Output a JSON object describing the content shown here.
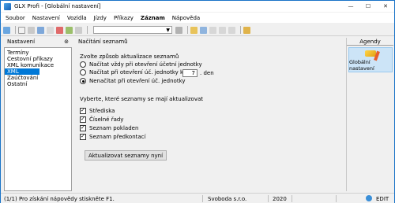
{
  "window": {
    "title": "GLX Profi - [Globální nastavení]"
  },
  "menubar": [
    "Soubor",
    "Nastavení",
    "Vozidla",
    "Jízdy",
    "Příkazy",
    "Záznam",
    "Nápověda"
  ],
  "left": {
    "header": "Nastavení",
    "items": [
      "Termíny",
      "Cestovní příkazy",
      "XML komunikace",
      "XML seznamy",
      "Zaúčtování",
      "Ostatní"
    ],
    "selected_index": 3
  },
  "content": {
    "section_title": "Načítání seznamů",
    "update_title": "Zvolte způsob aktualizace seznamů",
    "radios": [
      {
        "label": "Načítat vždy při otevření účetní jednotky",
        "checked": false
      },
      {
        "label": "Načítat při otevření úč. jednotky každý",
        "checked": false
      },
      {
        "label": "Nenačítat při otevření úč. jednotky",
        "checked": true
      }
    ],
    "interval_value": "7",
    "interval_unit": ". den",
    "lists_title": "Vyberte, které seznamy se mají aktualizovat",
    "checks": [
      {
        "label": "Střediska",
        "checked": true
      },
      {
        "label": "Číselné řady",
        "checked": true
      },
      {
        "label": "Seznam pokladen",
        "checked": true
      },
      {
        "label": "Seznam předkontací",
        "checked": true
      }
    ],
    "update_button": "Aktualizovat seznamy nyní"
  },
  "right": {
    "header": "Agendy",
    "tile_label": "Globální nastavení"
  },
  "status": {
    "hint": "(1/1) Pro získání nápovědy stiskněte F1.",
    "company": "Svoboda s.r.o.",
    "year": "2020",
    "mode": "EDIT"
  },
  "colors": {
    "accent": "#0078d7",
    "tile_bg": "#cce4f7"
  }
}
